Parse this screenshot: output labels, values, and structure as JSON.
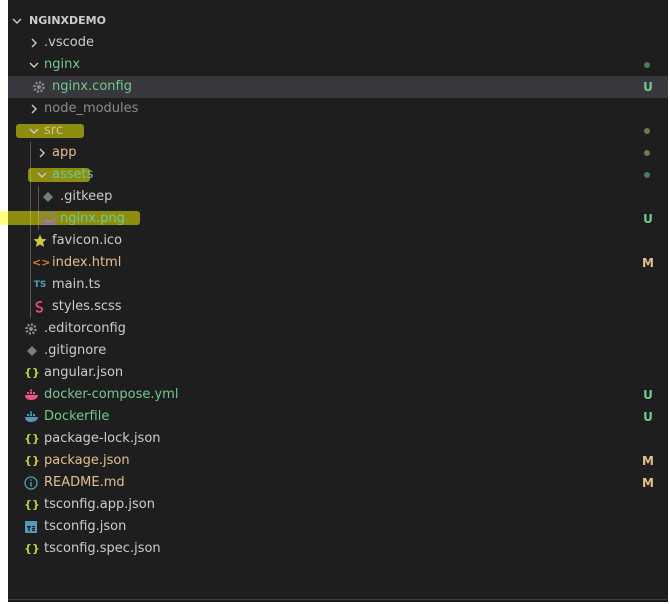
{
  "explorer": {
    "title": "NGINXDEMO",
    "items": [
      {
        "label": ".vscode",
        "status": "",
        "dot": ""
      },
      {
        "label": "nginx",
        "status": "",
        "dot": "#4d7b5b"
      },
      {
        "label": "nginx.config",
        "status": "U",
        "dot": ""
      },
      {
        "label": "node_modules",
        "status": "",
        "dot": ""
      },
      {
        "label": "src",
        "status": "",
        "dot": "#7d6f5a"
      },
      {
        "label": "app",
        "status": "",
        "dot": "#7d6f5a"
      },
      {
        "label": "assets",
        "status": "",
        "dot": "#4d7b5b"
      },
      {
        "label": ".gitkeep",
        "status": "",
        "dot": ""
      },
      {
        "label": "nginx.png",
        "status": "U",
        "dot": ""
      },
      {
        "label": "favicon.ico",
        "status": "",
        "dot": ""
      },
      {
        "label": "index.html",
        "status": "M",
        "dot": ""
      },
      {
        "label": "main.ts",
        "status": "",
        "dot": ""
      },
      {
        "label": "styles.scss",
        "status": "",
        "dot": ""
      },
      {
        "label": ".editorconfig",
        "status": "",
        "dot": ""
      },
      {
        "label": ".gitignore",
        "status": "",
        "dot": ""
      },
      {
        "label": "angular.json",
        "status": "",
        "dot": ""
      },
      {
        "label": "docker-compose.yml",
        "status": "U",
        "dot": ""
      },
      {
        "label": "Dockerfile",
        "status": "U",
        "dot": ""
      },
      {
        "label": "package-lock.json",
        "status": "",
        "dot": ""
      },
      {
        "label": "package.json",
        "status": "M",
        "dot": ""
      },
      {
        "label": "README.md",
        "status": "M",
        "dot": ""
      },
      {
        "label": "tsconfig.app.json",
        "status": "",
        "dot": ""
      },
      {
        "label": "tsconfig.json",
        "status": "",
        "dot": ""
      },
      {
        "label": "tsconfig.spec.json",
        "status": "",
        "dot": ""
      }
    ],
    "icons": {
      "ts_badge": "TS",
      "json_braces": "{}",
      "html_brackets": "<>",
      "info": "i"
    }
  },
  "colors": {
    "untracked": "#73c991",
    "modified": "#e2c08d",
    "ignored": "#8c8c8c",
    "default": "#cccccc",
    "highlighter": "#ffff00"
  }
}
